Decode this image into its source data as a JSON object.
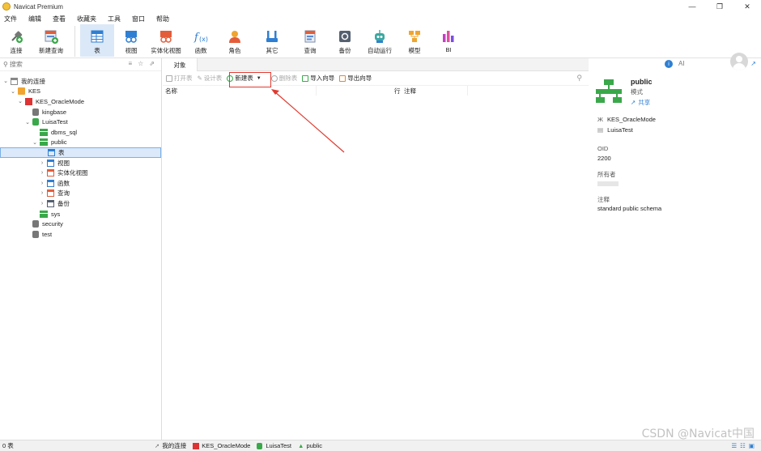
{
  "window": {
    "title": "Navicat Premium"
  },
  "menu": [
    "文件",
    "编辑",
    "查看",
    "收藏夹",
    "工具",
    "窗口",
    "帮助"
  ],
  "toolbar": [
    {
      "label": "连接",
      "icon": "plug-icon"
    },
    {
      "label": "新建查询",
      "icon": "new-query-icon"
    },
    {
      "label": "表",
      "icon": "table-icon",
      "active": true
    },
    {
      "label": "视图",
      "icon": "view-icon"
    },
    {
      "label": "实体化视图",
      "icon": "materialized-view-icon"
    },
    {
      "label": "函数",
      "icon": "function-icon"
    },
    {
      "label": "角色",
      "icon": "role-icon"
    },
    {
      "label": "其它",
      "icon": "tools-icon"
    },
    {
      "label": "查询",
      "icon": "query-icon"
    },
    {
      "label": "备份",
      "icon": "backup-icon"
    },
    {
      "label": "自动运行",
      "icon": "robot-icon"
    },
    {
      "label": "模型",
      "icon": "model-icon"
    },
    {
      "label": "BI",
      "icon": "bi-icon"
    }
  ],
  "sidebar": {
    "search_placeholder": "搜索",
    "tree": [
      {
        "label": "我的连接",
        "level": 0,
        "open": true,
        "icon": "connections-icon"
      },
      {
        "label": "KES",
        "level": 1,
        "open": true,
        "icon": "folder-icon"
      },
      {
        "label": "KES_OracleMode",
        "level": 2,
        "open": true,
        "icon": "kes-icon"
      },
      {
        "label": "kingbase",
        "level": 3,
        "open": false,
        "icon": "database-icon"
      },
      {
        "label": "LuisaTest",
        "level": 3,
        "open": true,
        "icon": "database-green-icon"
      },
      {
        "label": "dbms_sql",
        "level": 4,
        "open": false,
        "icon": "schema-icon"
      },
      {
        "label": "public",
        "level": 4,
        "open": true,
        "icon": "schema-icon"
      },
      {
        "label": "表",
        "level": 5,
        "open": false,
        "icon": "table-icon",
        "selected": true
      },
      {
        "label": "视图",
        "level": 5,
        "open": false,
        "icon": "view-icon",
        "twisty": true
      },
      {
        "label": "实体化视图",
        "level": 5,
        "open": false,
        "icon": "materialized-view-icon",
        "twisty": true
      },
      {
        "label": "函数",
        "level": 5,
        "open": false,
        "icon": "function-icon",
        "twisty": true
      },
      {
        "label": "查询",
        "level": 5,
        "open": false,
        "icon": "query-icon",
        "twisty": true
      },
      {
        "label": "备份",
        "level": 5,
        "open": false,
        "icon": "backup-icon",
        "twisty": true
      },
      {
        "label": "sys",
        "level": 4,
        "open": false,
        "icon": "schema-icon"
      },
      {
        "label": "security",
        "level": 3,
        "open": false,
        "icon": "database-icon"
      },
      {
        "label": "test",
        "level": 3,
        "open": false,
        "icon": "database-icon"
      }
    ]
  },
  "main": {
    "tab": "对象",
    "toolbar": [
      {
        "label": "打开表",
        "enabled": false
      },
      {
        "label": "设计表",
        "enabled": false
      },
      {
        "label": "新建表",
        "enabled": true,
        "dropdown": true
      },
      {
        "label": "删除表",
        "enabled": false
      },
      {
        "label": "导入向导",
        "enabled": true
      },
      {
        "label": "导出向导",
        "enabled": true
      }
    ],
    "columns": {
      "name": "名称",
      "rows": "行",
      "comment": "注释"
    }
  },
  "info": {
    "ai_label": "AI",
    "name": "public",
    "type": "模式",
    "share": "共享",
    "connection": "KES_OracleMode",
    "database": "LuisaTest",
    "oid_label": "OID",
    "oid": "2200",
    "owner_label": "所有者",
    "comment_label": "注释",
    "comment": "standard public schema"
  },
  "status": {
    "count": "0 表",
    "crumbs": [
      "我的连接",
      "KES_OracleMode",
      "LuisaTest",
      "public"
    ]
  },
  "watermark": "CSDN @Navicat中国",
  "colors": {
    "accent": "#2f7fd3",
    "highlight": "#e03a2f",
    "active_bg": "#dbe8f7"
  }
}
